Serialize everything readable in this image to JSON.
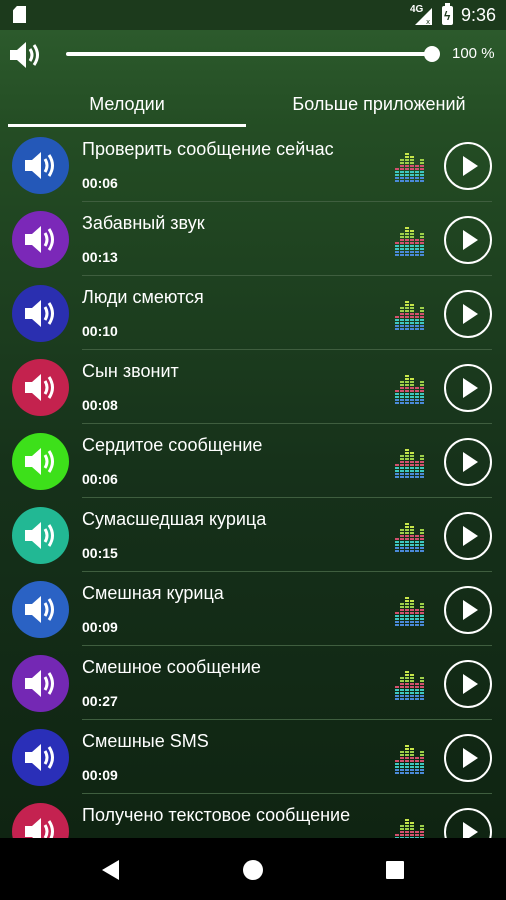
{
  "status_bar": {
    "network": "4G",
    "battery_icon": "battery-charging-icon",
    "time": "9:36"
  },
  "volume": {
    "percent_label": "100 %",
    "level": 1.0,
    "icon": "volume-icon"
  },
  "tabs": [
    {
      "label": "Мелодии",
      "selected": true
    },
    {
      "label": "Больше приложений",
      "selected": false
    }
  ],
  "ringtones": [
    {
      "title": "Проверить сообщение сейчас",
      "duration": "00:06",
      "color": "#2458b8"
    },
    {
      "title": "Забавный звук",
      "duration": "00:13",
      "color": "#7b28b8"
    },
    {
      "title": "Люди смеются",
      "duration": "00:10",
      "color": "#2a2fb0"
    },
    {
      "title": "Сын звонит",
      "duration": "00:08",
      "color": "#c4224e"
    },
    {
      "title": "Сердитое сообщение",
      "duration": "00:06",
      "color": "#3de01a"
    },
    {
      "title": "Сумасшедшая курица",
      "duration": "00:15",
      "color": "#22b894"
    },
    {
      "title": "Смешная курица",
      "duration": "00:09",
      "color": "#2a62c4"
    },
    {
      "title": "Смешное сообщение",
      "duration": "00:27",
      "color": "#7428b4"
    },
    {
      "title": "Смешные SMS",
      "duration": "00:09",
      "color": "#2a2fb8"
    },
    {
      "title": "Получено текстовое сообщение",
      "duration": "",
      "color": "#c42250"
    }
  ],
  "nav": {
    "back": "back-icon",
    "home": "home-icon",
    "recents": "recents-icon"
  }
}
